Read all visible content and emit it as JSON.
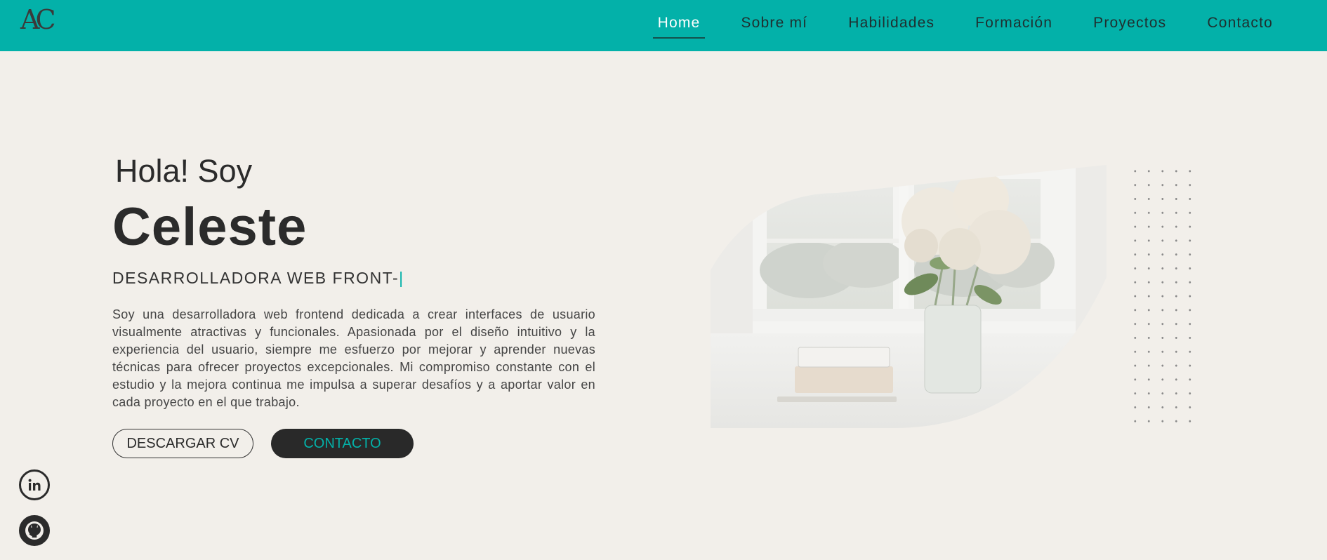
{
  "header": {
    "logo": "AC",
    "nav": [
      {
        "label": "Home",
        "active": true
      },
      {
        "label": "Sobre mí"
      },
      {
        "label": "Habilidades"
      },
      {
        "label": "Formación"
      },
      {
        "label": "Proyectos"
      },
      {
        "label": "Contacto"
      }
    ]
  },
  "hero": {
    "greeting": "Hola! Soy",
    "name": "Celeste",
    "role": "DESARROLLADORA WEB FRONT-",
    "cursor": "|",
    "description": "Soy una desarrolladora web frontend dedicada a crear interfaces de usuario visualmente atractivas y funcionales. Apasionada por el diseño intuitivo y la experiencia del usuario, siempre me esfuerzo por mejorar y aprender nuevas técnicas para ofrecer proyectos excepcionales. Mi compromiso constante con el estudio y la mejora continua me impulsa a superar desafíos y a aportar valor en cada proyecto en el que trabajo.",
    "cv_button": "DESCARGAR CV",
    "contact_button": "CONTACTO"
  },
  "social": {
    "linkedin_icon": "linkedin-icon",
    "github_icon": "github-icon"
  },
  "colors": {
    "accent": "#03b1a9",
    "background": "#f2efea",
    "dark": "#292929"
  }
}
